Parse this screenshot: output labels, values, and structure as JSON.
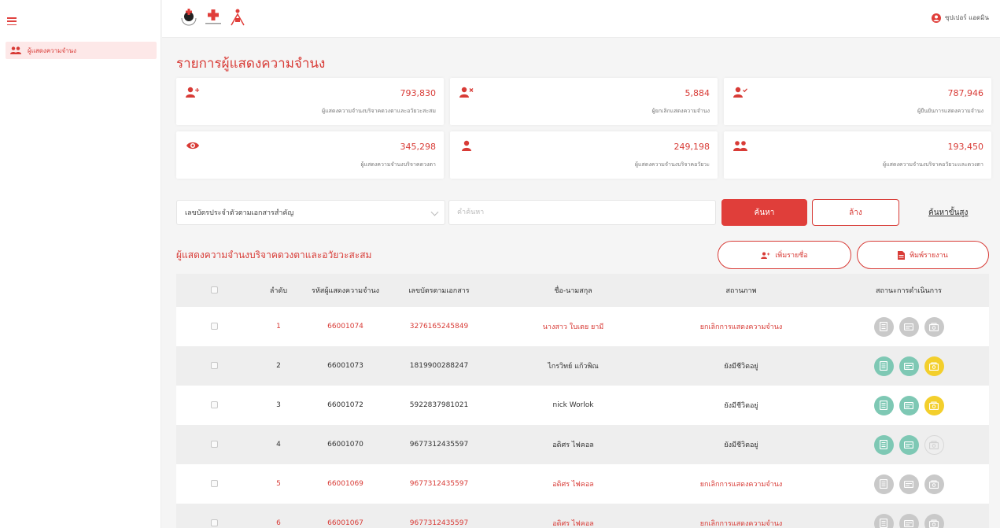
{
  "sidebar": {
    "items": [
      {
        "label": "ผู้แสดงความจำนง",
        "icon": "users-icon",
        "active": true
      }
    ]
  },
  "header": {
    "logos": [
      "red-cross-emblem-logo",
      "red-cross-logo",
      "organ-donation-logo"
    ],
    "user_name": "ซุปเปอร์ แอดมิน",
    "user_icon": "user-circle-icon"
  },
  "page": {
    "title": "รายการผู้แสดงความจำนง"
  },
  "stats": [
    {
      "value": "793,830",
      "label": "ผู้แสดงความจำนงบริจาคดวงตาและอวัยวะสะสม",
      "icon": "user-plus-icon"
    },
    {
      "value": "5,884",
      "label": "ผู้ยกเลิกแสดงความจำนง",
      "icon": "user-times-icon"
    },
    {
      "value": "787,946",
      "label": "ผู้ยืนยันการแสดงความจำนง",
      "icon": "user-check-icon"
    },
    {
      "value": "345,298",
      "label": "ผู้แสดงความจำนงบริจาคดวงตา",
      "icon": "eye-icon"
    },
    {
      "value": "249,198",
      "label": "ผู้แสดงความจำนงบริจาคอวัยวะ",
      "icon": "user-icon"
    },
    {
      "value": "193,450",
      "label": "ผู้แสดงความจำนงบริจาคอวัยวะและดวงตา",
      "icon": "users-icon"
    }
  ],
  "filter": {
    "select_value": "เลขบัตรประจำตัวตามเอกสารสำคัญ",
    "search_placeholder": "คำค้นหา",
    "search_label": "ค้นหา",
    "clear_label": "ล้าง",
    "advanced_label": "ค้นหาขั้นสูง"
  },
  "section": {
    "title": "ผู้แสดงความจำนงบริจาคดวงตาและอวัยวะสะสม",
    "add_label": "เพิ่มรายชื่อ",
    "print_label": "พิมพ์รายงาน"
  },
  "table": {
    "headers": [
      "ลำดับ",
      "รหัสผู้แสดงความจำนง",
      "เลขบัตรตามเอกสาร",
      "ชื่อ-นามสกุล",
      "สถานภาพ",
      "สถานะการดำเนินการ"
    ],
    "rows": [
      {
        "no": "1",
        "code": "66001074",
        "doc": "3276165245849",
        "name": "นางสาว ใบเตย ยามี",
        "status": "ยกเลิกการแสดงความจำนง",
        "cancelled": true,
        "actions": [
          "grey",
          "grey",
          "grey"
        ]
      },
      {
        "no": "2",
        "code": "66001073",
        "doc": "1819900288247",
        "name": "ไกรวิทย์ แก้วพิณ",
        "status": "ยังมีชีวิตอยู่",
        "cancelled": false,
        "actions": [
          "teal",
          "teal",
          "yellow"
        ]
      },
      {
        "no": "3",
        "code": "66001072",
        "doc": "5922837981021",
        "name": "nick Worlok",
        "status": "ยังมีชีวิตอยู่",
        "cancelled": false,
        "actions": [
          "teal",
          "teal",
          "yellow"
        ]
      },
      {
        "no": "4",
        "code": "66001070",
        "doc": "9677312435597",
        "name": "อดิศร ไฟคอล",
        "status": "ยังมีชีวิตอยู่",
        "cancelled": false,
        "actions": [
          "teal",
          "teal",
          "outline"
        ]
      },
      {
        "no": "5",
        "code": "66001069",
        "doc": "9677312435597",
        "name": "อดิศร ไฟคอล",
        "status": "ยกเลิกการแสดงความจำนง",
        "cancelled": true,
        "actions": [
          "grey",
          "grey",
          "grey"
        ]
      },
      {
        "no": "6",
        "code": "66001067",
        "doc": "9677312435597",
        "name": "อดิศร ไฟคอล",
        "status": "ยกเลิกการแสดงความจำนง",
        "cancelled": true,
        "actions": [
          "grey",
          "grey",
          "grey"
        ]
      }
    ]
  },
  "colors": {
    "accent": "#d83b36",
    "teal": "#7ec8b4",
    "yellow": "#f3cf2c",
    "grey": "#c9c9c9"
  }
}
